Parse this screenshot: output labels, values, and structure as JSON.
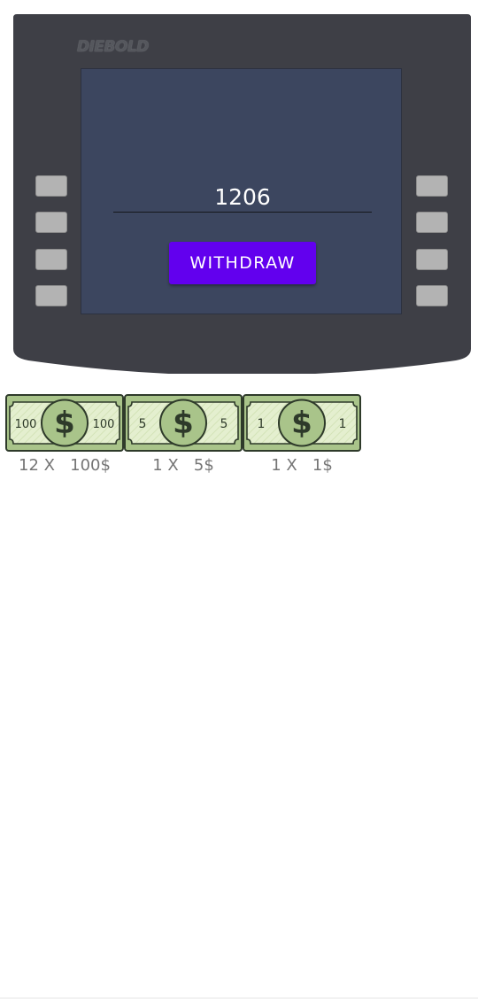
{
  "atm": {
    "brand": "DIEBOLD",
    "amount_value": "1206",
    "withdraw_label": "WITHDRAW",
    "colors": {
      "body": "#3e3f46",
      "screen": "#3c465f",
      "button": "#6200ee"
    }
  },
  "notes": [
    {
      "denomination_label": "100",
      "count_text": "12 X   100$"
    },
    {
      "denomination_label": "5",
      "count_text": "1 X   5$"
    },
    {
      "denomination_label": "1",
      "count_text": "1 X   1$"
    }
  ],
  "icons": {
    "note_icon": "dollar-bill-icon"
  }
}
